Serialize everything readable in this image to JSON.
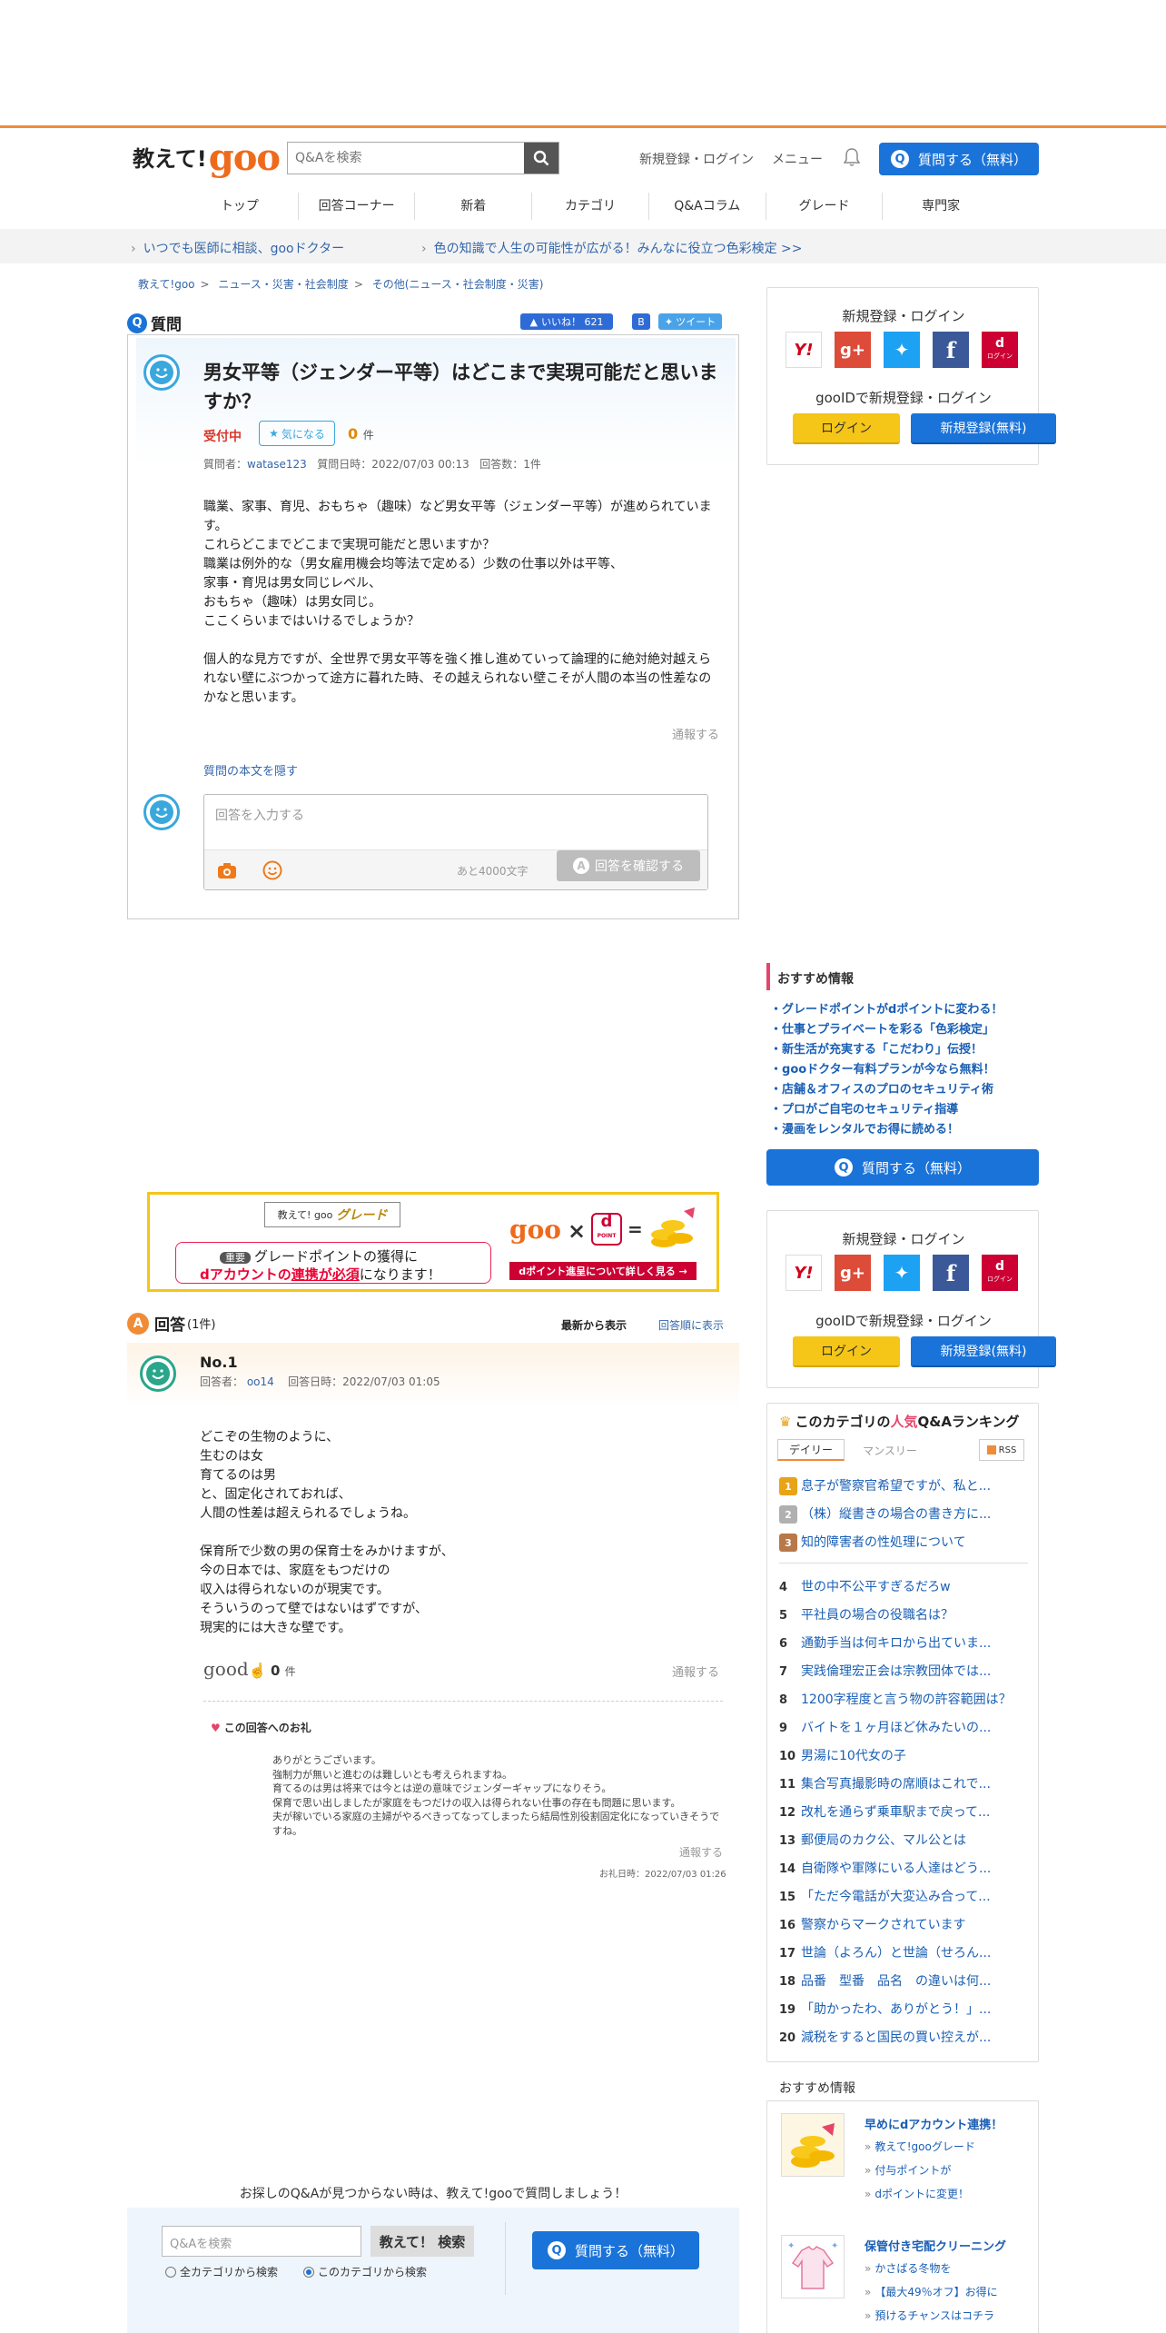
{
  "header": {
    "logo_text_1": "教えて!",
    "logo_text_2": "goo",
    "search_placeholder": "Q&Aを検索",
    "login_link": "新規登録・ログイン",
    "menu_link": "メニュー",
    "ask_button": "質問する（無料）"
  },
  "nav": [
    "トップ",
    "回答コーナー",
    "新着",
    "カテゴリ",
    "Q&Aコラム",
    "グレード",
    "専門家"
  ],
  "promos": [
    "いつでも医師に相談、gooドクター",
    "色の知識で人生の可能性が広がる！みんなに役立つ色彩検定 >>"
  ],
  "breadcrumb": [
    "教えて!goo",
    "ニュース・災害・社会制度",
    "その他(ニュース・社会制度・災害)"
  ],
  "question": {
    "section_label": "質問",
    "like_label": "いいね！",
    "like_count": "621",
    "tweet_label": "ツイート",
    "title": "男女平等（ジェンダー平等）はどこまで実現可能だと思いますか？",
    "status": "受付中",
    "kininaru_label": "気になる",
    "kininaru_count": "0",
    "count_unit": "件",
    "meta_author_label": "質問者：",
    "meta_author": "watase123",
    "meta_date": "質問日時：2022/07/03 00:13",
    "meta_answers": "回答数：1件",
    "body": [
      "職業、家事、育児、おもちゃ（趣味）など男女平等（ジェンダー平等）が進められています。",
      "これらどこまでどこまで実現可能だと思いますか？",
      "職業は例外的な（男女雇用機会均等法で定める）少数の仕事以外は平等、",
      "家事・育児は男女同じレベル、",
      "おもちゃ（趣味）は男女同じ。",
      "ここくらいまではいけるでしょうか？",
      "",
      "個人的な見方ですが、全世界で男女平等を強く推し進めていって論理的に絶対絶対越えられない壁にぶつかって途方に暮れた時、その越えられない壁こそが人間の本当の性差なのかなと思います。"
    ],
    "report_label": "通報する",
    "hide_body_label": "質問の本文を隠す",
    "answer_placeholder": "回答を入力する",
    "remaining_chars": "あと4000文字",
    "confirm_button": "回答を確認する"
  },
  "login_box": {
    "title": "新規登録・ログイン",
    "sub": "gooIDで新規登録・ログイン",
    "login_button": "ログイン",
    "register_button": "新規登録(無料)",
    "social_icons": [
      "yahoo-icon",
      "google-plus-icon",
      "twitter-icon",
      "facebook-icon",
      "d-account-icon"
    ],
    "d_login_label": "ログイン"
  },
  "osusume": {
    "title": "おすすめ情報",
    "items": [
      "グレードポイントがdポイントに変わる！",
      "仕事とプライベートを彩る「色彩検定」",
      "新生活が充実する「こだわり」伝授！",
      "gooドクター有料プランが今なら無料！",
      "店舗＆オフィスのプロのセキュリティ術",
      "プロがご自宅のセキュリティ指導",
      "漫画をレンタルでお得に読める！"
    ],
    "ask_button": "質問する（無料）"
  },
  "grade_banner": {
    "badge": "教えて! goo",
    "grade": "グレード",
    "tag": "重要",
    "line1": "グレードポイントの獲得に",
    "line2a": "dアカウントの",
    "line2b": "連携が必須",
    "line2c": "になります！",
    "goo": "goo",
    "times": "×",
    "equals": "=",
    "dpoint": "POINT",
    "detail_button": "dポイント進呈について詳しく見る →"
  },
  "answers": {
    "section_label": "回答",
    "count": "(1件)",
    "sort_new": "最新から表示",
    "sort_order": "回答順に表示",
    "items": [
      {
        "no": "No.1",
        "author_label": "回答者：",
        "author": "oo14",
        "date": "回答日時：2022/07/03 01:05",
        "body": [
          "どこぞの生物のように、",
          "生むのは女",
          "育てるのは男",
          "と、固定化されておれば、",
          "人間の性差は超えられるでしょうね。",
          "",
          "保育所で少数の男の保育士をみかけますが、",
          "今の日本では、家庭をもつだけの",
          "収入は得られないのが現実です。",
          "そういうのって壁ではないはずですが、",
          "現実的には大きな壁です。"
        ],
        "good_label": "good",
        "good_count": "0",
        "good_unit": "件",
        "report_label": "通報する",
        "thanks_title": "この回答へのお礼",
        "thanks_body": [
          "ありがとうございます。",
          "強制力が無いと進むのは難しいとも考えられますね。",
          "育てるのは男は将来では今とは逆の意味でジェンダーギャップになりそう。",
          "保育で思い出しましたが家庭をもつだけの収入は得られない仕事の存在も問題に思います。",
          "夫が稼いでいる家庭の主婦がやるべきってなってしまったら結局性別役割固定化になっていきそうですね。"
        ],
        "thanks_report": "通報する",
        "thanks_date": "お礼日時：2022/07/03 01:26"
      }
    ]
  },
  "ranking": {
    "title_pre": "このカテゴリの",
    "title_hot": "人気",
    "title_post": "Q&Aランキング",
    "tab_daily": "デイリー",
    "tab_monthly": "マンスリー",
    "rss": "RSS",
    "items": [
      {
        "n": "1",
        "t": "息子が警察官希望ですが、私と..."
      },
      {
        "n": "2",
        "t": "（株）縦書きの場合の書き方に..."
      },
      {
        "n": "3",
        "t": "知的障害者の性処理について"
      },
      {
        "n": "4",
        "t": "世の中不公平すぎるだろw"
      },
      {
        "n": "5",
        "t": "平社員の場合の役職名は？"
      },
      {
        "n": "6",
        "t": "通勤手当は何キロから出ていま..."
      },
      {
        "n": "7",
        "t": "実践倫理宏正会は宗教団体では..."
      },
      {
        "n": "8",
        "t": "1200字程度と言う物の許容範囲は？"
      },
      {
        "n": "9",
        "t": "バイトを１ヶ月ほど休みたいの..."
      },
      {
        "n": "10",
        "t": "男湯に10代女の子"
      },
      {
        "n": "11",
        "t": "集合写真撮影時の席順はこれで..."
      },
      {
        "n": "12",
        "t": "改札を通らず乗車駅まで戻って..."
      },
      {
        "n": "13",
        "t": "郵便局のカク公、マル公とは"
      },
      {
        "n": "14",
        "t": "自衛隊や軍隊にいる人達はどう..."
      },
      {
        "n": "15",
        "t": "「ただ今電話が大変込み合って..."
      },
      {
        "n": "16",
        "t": "警察からマークされています"
      },
      {
        "n": "17",
        "t": "世論（よろん）と世論（せろん..."
      },
      {
        "n": "18",
        "t": "品番　型番　品名　の違いは何..."
      },
      {
        "n": "19",
        "t": "「助かったわ、ありがとう！」..."
      },
      {
        "n": "20",
        "t": "減税をすると国民の買い控えが..."
      }
    ]
  },
  "osusume2": {
    "title": "おすすめ情報",
    "cards": [
      {
        "title": "早めにdアカウント連携！",
        "links": [
          "教えて!gooグレード",
          "付与ポイントが",
          "dポイントに変更！"
        ]
      },
      {
        "title": "保管付き宅配クリーニング",
        "links": [
          "かさばる冬物を",
          "【最大49％オフ】お得に",
          "預けるチャンスはコチラ"
        ]
      }
    ]
  },
  "bottom": {
    "heading": "お探しのQ&Aが見つからない時は、教えて!gooで質問しましょう！",
    "search_placeholder": "Q&Aを検索",
    "search_button": "教えて！ 検索",
    "radio_all": "全カテゴリから検索",
    "radio_this": "このカテゴリから検索",
    "ask_button": "質問する（無料）"
  },
  "colors": {
    "accent_orange": "#f08c36",
    "brand_blue": "#1a73d9",
    "status_red": "#d9382c"
  }
}
